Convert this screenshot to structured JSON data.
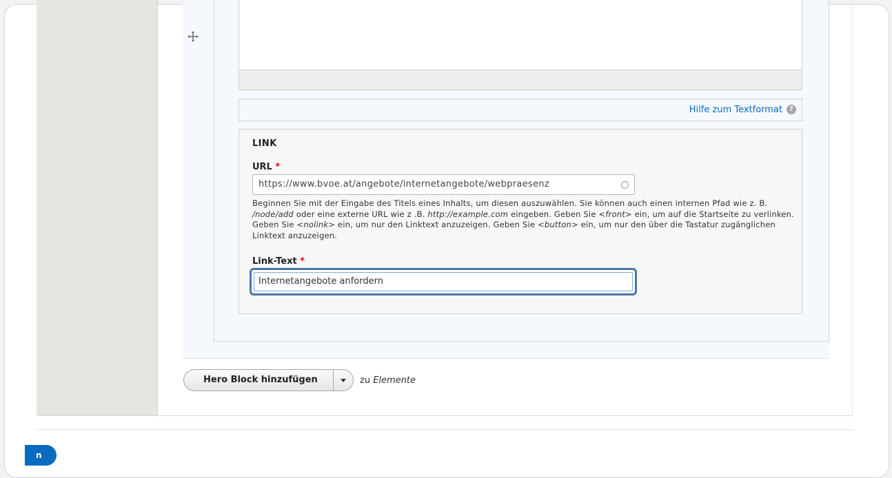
{
  "editor": {
    "format_help_link": "Hilfe zum Textformat",
    "help_icon": "?"
  },
  "link_field": {
    "legend": "LINK",
    "url_label": "URL",
    "required_marker": "*",
    "url_value": "https://www.bvoe.at/angebote/internetangebote/webpraesenz",
    "description": {
      "p1": "Beginnen Sie mit der Eingabe des Titels eines Inhalts, um diesen auszuwählen. Sie können auch einen internen Pfad wie z. B. ",
      "e1": "/node/add",
      "p2": " oder eine externe URL wie z .B. ",
      "e2": "http://example.com",
      "p3": " eingeben. Geben Sie ",
      "e3": "<front>",
      "p4": " ein, um auf die Startseite zu verlinken. Geben Sie ",
      "e4": "<nolink>",
      "p5": " ein, um nur den Linktext anzuzeigen. Geben Sie ",
      "e5": "<button>",
      "p6": " ein, um nur den über die Tastatur zugänglichen Linktext anzuzeigen."
    },
    "link_text_label": "Link-Text",
    "link_text_value": "Internetangebote anfordern"
  },
  "add_paragraph": {
    "button_label": "Hero Block hinzufügen",
    "zu": "zu ",
    "target": "Elemente"
  },
  "footer": {
    "save_label": "n"
  },
  "icons": {
    "drag": "drag-handle-icon",
    "help": "question-circle-icon",
    "dropdown": "chevron-down-icon",
    "throbber": "autocomplete-throbber-icon"
  },
  "colors": {
    "accent": "#0a6bbf",
    "focus": "#4a74a8",
    "required": "#ee0000"
  }
}
